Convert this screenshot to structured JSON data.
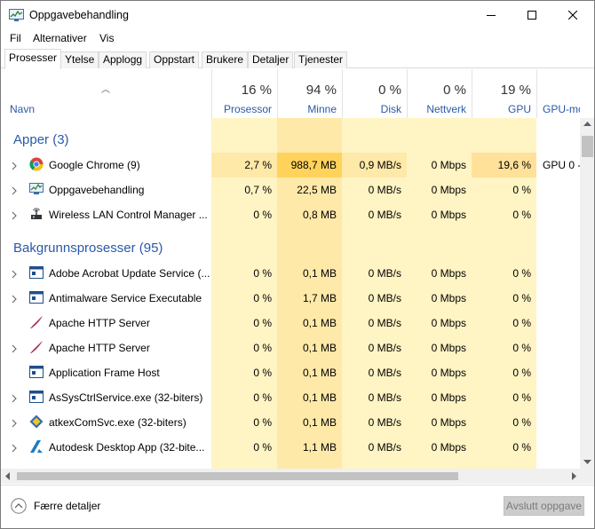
{
  "window": {
    "title": "Oppgavebehandling"
  },
  "menu": [
    "Fil",
    "Alternativer",
    "Vis"
  ],
  "tabs": [
    "Prosesser",
    "Ytelse",
    "Applogg",
    "Oppstart",
    "Brukere",
    "Detaljer",
    "Tjenester"
  ],
  "active_tab": "Prosesser",
  "columns": {
    "name": "Navn",
    "cpu": {
      "label": "Prosessor",
      "pct": "16 %"
    },
    "mem": {
      "label": "Minne",
      "pct": "94 %"
    },
    "disk": {
      "label": "Disk",
      "pct": "0 %"
    },
    "net": {
      "label": "Nettverk",
      "pct": "0 %"
    },
    "gpu": {
      "label": "GPU",
      "pct": "19 %"
    },
    "gpu_engine": {
      "label": "GPU-moto"
    }
  },
  "groups": {
    "apps": "Apper (3)",
    "background": "Bakgrunnsprosesser (95)"
  },
  "apps": [
    {
      "name": "Google Chrome (9)",
      "icon": "chrome-icon",
      "expandable": true,
      "cpu": "2,7 %",
      "mem": "988,7 MB",
      "disk": "0,9 MB/s",
      "net": "0 Mbps",
      "gpu": "19,6 %",
      "gpu_engine": "GPU 0 -"
    },
    {
      "name": "Oppgavebehandling",
      "icon": "task-manager-icon",
      "expandable": true,
      "cpu": "0,7 %",
      "mem": "22,5 MB",
      "disk": "0 MB/s",
      "net": "0 Mbps",
      "gpu": "0 %",
      "gpu_engine": ""
    },
    {
      "name": "Wireless LAN Control Manager ...",
      "icon": "wireless-lan-icon",
      "expandable": true,
      "cpu": "0 %",
      "mem": "0,8 MB",
      "disk": "0 MB/s",
      "net": "0 Mbps",
      "gpu": "0 %",
      "gpu_engine": ""
    }
  ],
  "background": [
    {
      "name": "Adobe Acrobat Update Service (...",
      "icon": "window-icon",
      "expandable": true,
      "cpu": "0 %",
      "mem": "0,1 MB",
      "disk": "0 MB/s",
      "net": "0 Mbps",
      "gpu": "0 %"
    },
    {
      "name": "Antimalware Service Executable",
      "icon": "window-icon",
      "expandable": true,
      "cpu": "0 %",
      "mem": "1,7 MB",
      "disk": "0 MB/s",
      "net": "0 Mbps",
      "gpu": "0 %"
    },
    {
      "name": "Apache HTTP Server",
      "icon": "apache-feather-icon",
      "expandable": false,
      "cpu": "0 %",
      "mem": "0,1 MB",
      "disk": "0 MB/s",
      "net": "0 Mbps",
      "gpu": "0 %"
    },
    {
      "name": "Apache HTTP Server",
      "icon": "apache-feather-icon",
      "expandable": true,
      "cpu": "0 %",
      "mem": "0,1 MB",
      "disk": "0 MB/s",
      "net": "0 Mbps",
      "gpu": "0 %"
    },
    {
      "name": "Application Frame Host",
      "icon": "window-icon",
      "expandable": false,
      "cpu": "0 %",
      "mem": "0,1 MB",
      "disk": "0 MB/s",
      "net": "0 Mbps",
      "gpu": "0 %"
    },
    {
      "name": "AsSysCtrlService.exe (32-biters)",
      "icon": "window-icon",
      "expandable": true,
      "cpu": "0 %",
      "mem": "0,1 MB",
      "disk": "0 MB/s",
      "net": "0 Mbps",
      "gpu": "0 %"
    },
    {
      "name": "atkexComSvc.exe (32-biters)",
      "icon": "atk-icon",
      "expandable": true,
      "cpu": "0 %",
      "mem": "0,1 MB",
      "disk": "0 MB/s",
      "net": "0 Mbps",
      "gpu": "0 %"
    },
    {
      "name": "Autodesk Desktop App (32-bite...",
      "icon": "autodesk-icon",
      "expandable": true,
      "cpu": "0 %",
      "mem": "1,1 MB",
      "disk": "0 MB/s",
      "net": "0 Mbps",
      "gpu": "0 %"
    }
  ],
  "footer": {
    "fewer_details": "Færre detaljer",
    "end_task": "Avslutt oppgave"
  },
  "colors": {
    "heat_light": "#fff4c4",
    "heat_medium": "#ffe9a8",
    "heat_hot": "#ffd35b",
    "heat_warm": "#ffe19a",
    "accent_blue": "#2a5aa8"
  }
}
